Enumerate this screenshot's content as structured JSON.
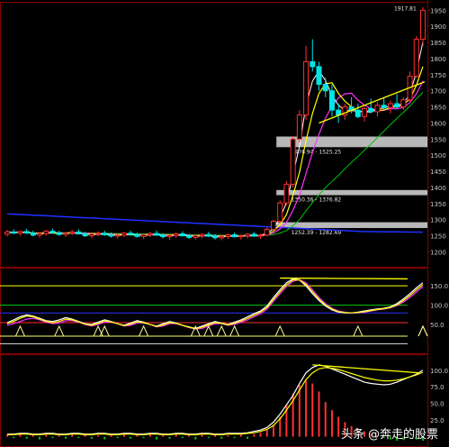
{
  "chart_data": [
    {
      "type": "candlestick",
      "panel": "price",
      "ylim": [
        1165,
        1965
      ],
      "y_ticks": [
        "1950",
        "1900",
        "1850",
        "1800",
        "1750",
        "1700",
        "1650",
        "1600",
        "1550",
        "1500",
        "1450",
        "1400",
        "1350",
        "1300",
        "1250",
        "1200"
      ],
      "high_label": "1917.81",
      "resistance_zones": [
        {
          "low": 1525,
          "high": 1558,
          "label": "1476.94 - 1525.25"
        },
        {
          "low": 1376,
          "high": 1392,
          "label": "1350.36 - 1376.82"
        },
        {
          "low": 1274,
          "high": 1292,
          "label": "1252.39 - 1282.69"
        }
      ],
      "candles": [
        [
          1255,
          1268,
          1248,
          1262
        ],
        [
          1262,
          1270,
          1256,
          1258
        ],
        [
          1258,
          1266,
          1250,
          1263
        ],
        [
          1263,
          1272,
          1255,
          1259
        ],
        [
          1259,
          1266,
          1248,
          1252
        ],
        [
          1252,
          1262,
          1244,
          1257
        ],
        [
          1257,
          1268,
          1250,
          1264
        ],
        [
          1264,
          1272,
          1256,
          1260
        ],
        [
          1260,
          1266,
          1250,
          1254
        ],
        [
          1254,
          1262,
          1246,
          1258
        ],
        [
          1258,
          1268,
          1252,
          1262
        ],
        [
          1262,
          1270,
          1254,
          1256
        ],
        [
          1256,
          1262,
          1246,
          1250
        ],
        [
          1250,
          1258,
          1242,
          1255
        ],
        [
          1255,
          1264,
          1248,
          1258
        ],
        [
          1258,
          1266,
          1250,
          1253
        ],
        [
          1253,
          1260,
          1244,
          1249
        ],
        [
          1249,
          1256,
          1240,
          1252
        ],
        [
          1252,
          1262,
          1246,
          1258
        ],
        [
          1258,
          1266,
          1250,
          1254
        ],
        [
          1254,
          1260,
          1244,
          1248
        ],
        [
          1248,
          1256,
          1240,
          1253
        ],
        [
          1253,
          1262,
          1246,
          1257
        ],
        [
          1257,
          1266,
          1250,
          1252
        ],
        [
          1252,
          1258,
          1242,
          1247
        ],
        [
          1247,
          1254,
          1238,
          1251
        ],
        [
          1251,
          1260,
          1244,
          1256
        ],
        [
          1256,
          1264,
          1248,
          1250
        ],
        [
          1250,
          1256,
          1240,
          1245
        ],
        [
          1245,
          1254,
          1238,
          1250
        ],
        [
          1250,
          1258,
          1242,
          1254
        ],
        [
          1254,
          1262,
          1246,
          1249
        ],
        [
          1249,
          1256,
          1238,
          1244
        ],
        [
          1244,
          1252,
          1236,
          1248
        ],
        [
          1248,
          1256,
          1240,
          1253
        ],
        [
          1253,
          1260,
          1244,
          1247
        ],
        [
          1247,
          1254,
          1238,
          1250
        ],
        [
          1250,
          1258,
          1242,
          1255
        ],
        [
          1255,
          1262,
          1246,
          1249
        ],
        [
          1249,
          1256,
          1240,
          1252
        ],
        [
          1252,
          1276,
          1248,
          1270
        ],
        [
          1270,
          1300,
          1264,
          1295
        ],
        [
          1295,
          1360,
          1290,
          1352
        ],
        [
          1352,
          1420,
          1345,
          1410
        ],
        [
          1410,
          1560,
          1400,
          1550
        ],
        [
          1550,
          1640,
          1540,
          1625
        ],
        [
          1625,
          1840,
          1610,
          1790
        ],
        [
          1790,
          1860,
          1760,
          1775
        ],
        [
          1775,
          1790,
          1700,
          1720
        ],
        [
          1720,
          1740,
          1680,
          1700
        ],
        [
          1700,
          1720,
          1620,
          1640
        ],
        [
          1640,
          1660,
          1600,
          1625
        ],
        [
          1625,
          1660,
          1610,
          1650
        ],
        [
          1650,
          1680,
          1630,
          1640
        ],
        [
          1640,
          1660,
          1615,
          1620
        ],
        [
          1620,
          1650,
          1605,
          1645
        ],
        [
          1645,
          1675,
          1630,
          1635
        ],
        [
          1635,
          1665,
          1620,
          1655
        ],
        [
          1655,
          1680,
          1640,
          1648
        ],
        [
          1648,
          1670,
          1630,
          1660
        ],
        [
          1660,
          1690,
          1645,
          1650
        ],
        [
          1650,
          1680,
          1640,
          1672
        ],
        [
          1672,
          1760,
          1665,
          1745
        ],
        [
          1745,
          1870,
          1740,
          1860
        ],
        [
          1860,
          1960,
          1840,
          1950
        ]
      ]
    },
    {
      "type": "line",
      "panel": "oscillator",
      "ylim": [
        -15,
        190
      ],
      "y_ticks": [
        "150.0",
        "100.0",
        "50.0"
      ],
      "series": [
        {
          "color": "#ffffff",
          "values": [
            55,
            62,
            70,
            75,
            72,
            66,
            60,
            58,
            62,
            68,
            64,
            58,
            52,
            50,
            56,
            62,
            58,
            52,
            48,
            54,
            60,
            56,
            50,
            46,
            52,
            58,
            54,
            48,
            44,
            40,
            46,
            52,
            58,
            54,
            50,
            56,
            62,
            70,
            78,
            85,
            98,
            120,
            140,
            158,
            168,
            165,
            150,
            130,
            112,
            98,
            88,
            82,
            80,
            80,
            82,
            85,
            88,
            90,
            92,
            96,
            104,
            116,
            130,
            145,
            158
          ]
        },
        {
          "color": "#ff30ff",
          "values": [
            48,
            52,
            58,
            64,
            66,
            62,
            56,
            52,
            54,
            60,
            60,
            56,
            50,
            46,
            50,
            56,
            56,
            52,
            46,
            48,
            54,
            54,
            50,
            44,
            46,
            52,
            52,
            48,
            42,
            38,
            40,
            46,
            52,
            52,
            48,
            50,
            56,
            62,
            70,
            78,
            90,
            110,
            130,
            148,
            162,
            166,
            158,
            140,
            120,
            104,
            92,
            85,
            82,
            80,
            80,
            82,
            85,
            88,
            90,
            93,
            99,
            108,
            120,
            134,
            148
          ]
        },
        {
          "color": "#ffff00",
          "values": [
            52,
            58,
            66,
            72,
            70,
            64,
            58,
            55,
            58,
            64,
            62,
            57,
            51,
            48,
            53,
            59,
            57,
            52,
            47,
            51,
            57,
            55,
            50,
            45,
            49,
            55,
            53,
            48,
            43,
            39,
            43,
            49,
            55,
            53,
            49,
            53,
            59,
            66,
            74,
            82,
            94,
            115,
            135,
            153,
            165,
            165,
            154,
            135,
            116,
            101,
            90,
            83,
            81,
            80,
            81,
            83,
            86,
            89,
            91,
            94,
            101,
            112,
            125,
            140,
            153
          ]
        }
      ],
      "hlines": [
        {
          "value": 150,
          "color": "#ffff00"
        },
        {
          "value": 100,
          "color": "#00cc00"
        },
        {
          "value": 80,
          "color": "#3030ff"
        },
        {
          "value": 55,
          "color": "#ff3030"
        },
        {
          "value": 20,
          "color": "#ffff66"
        },
        {
          "value": 0,
          "color": "#cccccc"
        }
      ],
      "triangle_marks": [
        2,
        8,
        14,
        15,
        21,
        29,
        31,
        33,
        35,
        42,
        54,
        68,
        72
      ]
    },
    {
      "type": "bar",
      "panel": "volume_oscillator",
      "ylim": [
        -10,
        120
      ],
      "y_ticks": [
        "100.0",
        "75.0",
        "50.0",
        "25.0"
      ],
      "values": [
        3,
        -2,
        4,
        -3,
        2,
        -4,
        3,
        -2,
        2,
        -3,
        4,
        -2,
        3,
        -3,
        2,
        -4,
        3,
        -2,
        4,
        -3,
        2,
        -2,
        3,
        -4,
        2,
        -3,
        3,
        -2,
        2,
        -4,
        3,
        -2,
        4,
        -3,
        2,
        -2,
        3,
        -3,
        4,
        6,
        10,
        18,
        30,
        48,
        65,
        78,
        85,
        80,
        68,
        52,
        40,
        30,
        22,
        16,
        12,
        8,
        5,
        2,
        -2,
        -4,
        -6,
        -5,
        -3,
        -4,
        -6
      ],
      "series": [
        {
          "color": "#ffffff",
          "values": [
            4,
            4,
            5,
            5,
            4,
            4,
            5,
            5,
            4,
            4,
            5,
            5,
            4,
            4,
            5,
            5,
            4,
            4,
            5,
            5,
            4,
            4,
            5,
            5,
            4,
            4,
            5,
            5,
            4,
            4,
            5,
            5,
            4,
            4,
            5,
            5,
            5,
            6,
            8,
            10,
            14,
            22,
            34,
            48,
            62,
            80,
            96,
            104,
            108,
            106,
            102,
            98,
            94,
            90,
            86,
            82,
            80,
            79,
            78,
            79,
            82,
            86,
            90,
            94,
            100
          ]
        },
        {
          "color": "#ffff00",
          "values": [
            3,
            3,
            4,
            4,
            3,
            3,
            4,
            4,
            3,
            3,
            4,
            4,
            3,
            3,
            4,
            4,
            3,
            3,
            4,
            4,
            3,
            3,
            4,
            4,
            3,
            3,
            4,
            4,
            3,
            3,
            4,
            4,
            3,
            3,
            4,
            4,
            4,
            5,
            6,
            8,
            11,
            17,
            27,
            40,
            54,
            70,
            86,
            96,
            102,
            104,
            103,
            101,
            98,
            95,
            92,
            89,
            87,
            85,
            84,
            84,
            85,
            87,
            90,
            93,
            97
          ]
        }
      ],
      "trendline": {
        "from_value": 108,
        "to_value": 96
      }
    }
  ],
  "colors": {
    "up": "#ff3030",
    "down": "#00e5e5",
    "grid": "#800000",
    "axis_text": "#c8c8c8"
  },
  "watermark": "头条 @奔走的股票"
}
